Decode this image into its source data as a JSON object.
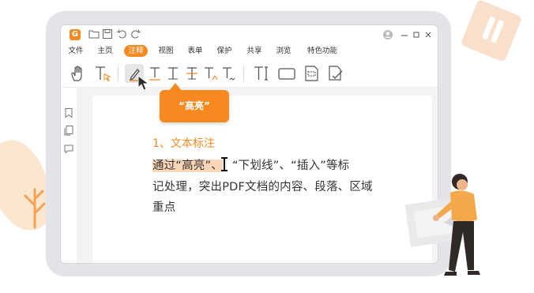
{
  "app": {
    "logo_label": "G",
    "menu": [
      "文件",
      "主页",
      "注释",
      "视图",
      "表单",
      "保护",
      "共享",
      "浏览",
      "特色功能"
    ],
    "active_menu": "注释",
    "window_controls": [
      "minimize",
      "maximize",
      "close"
    ]
  },
  "quick_access_icons": [
    "folder-icon",
    "save-icon",
    "undo-icon",
    "redo-icon"
  ],
  "toolbar_icons": [
    "hand-tool-icon",
    "select-text-icon",
    "highlight-pen-icon",
    "underline-text-icon",
    "strikeout-text-icon",
    "replace-text-icon",
    "insert-text-icon",
    "squiggly-text-icon",
    "typewriter-icon",
    "textbox-icon",
    "callout-icon",
    "note-check-icon"
  ],
  "sidebar_icons": [
    "bookmark-icon",
    "pages-icon",
    "comments-icon"
  ],
  "tooltip": {
    "text": "“高亮”"
  },
  "document": {
    "heading": "1、文本标注",
    "highlighted_text": "通过“高亮”、",
    "line1_rest": "“下划线”、“插入”等标",
    "line2": "记处理，突出PDF文档的内容、段落、区域",
    "line3": "重点"
  },
  "colors": {
    "accent": "#f6891f",
    "highlight": "#fbd6b6",
    "frame": "#e4e4e8"
  }
}
